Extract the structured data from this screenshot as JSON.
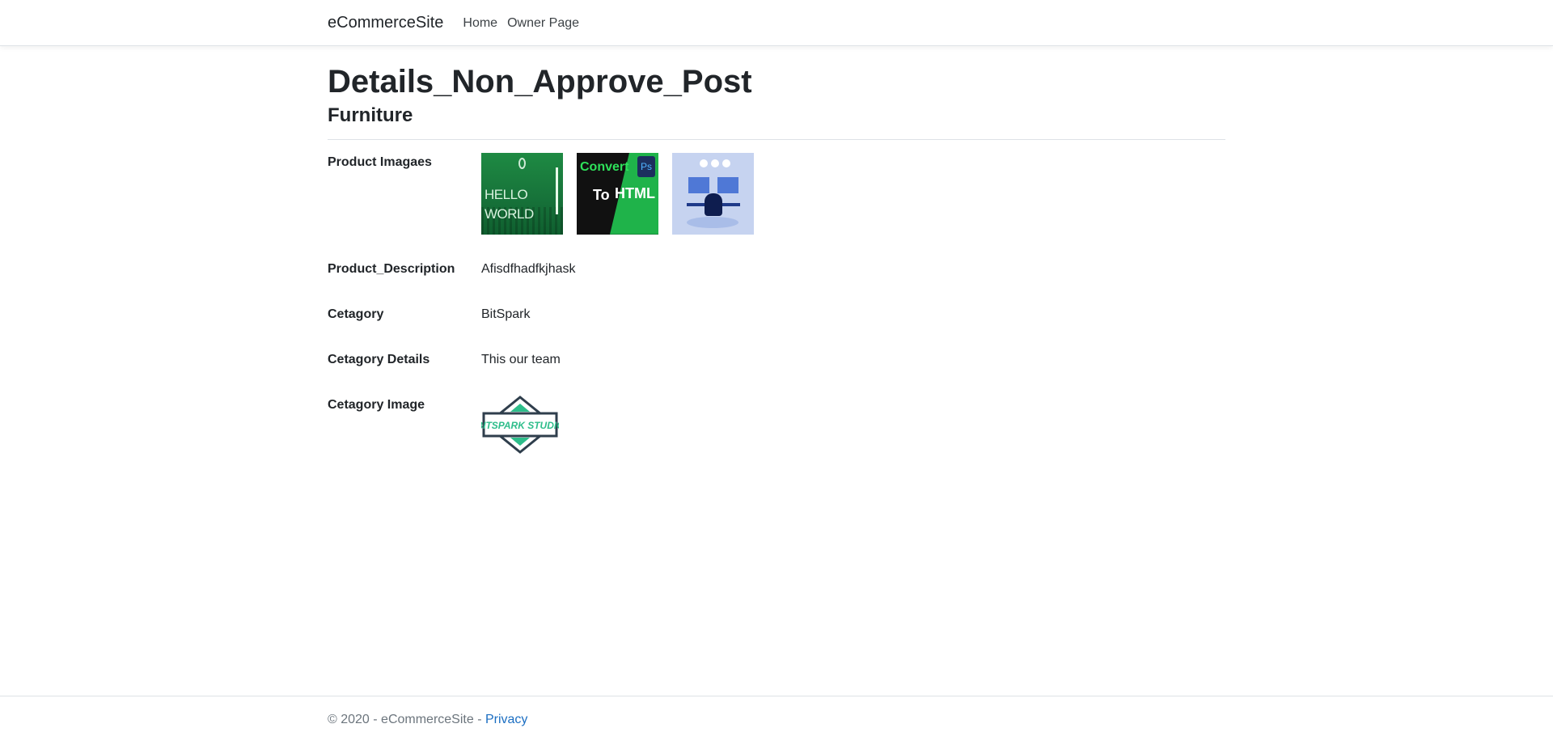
{
  "navbar": {
    "brand": "eCommerceSite",
    "links": [
      "Home",
      "Owner Page"
    ]
  },
  "page": {
    "title": "Details_Non_Approve_Post",
    "subtitle": "Furniture"
  },
  "details": {
    "product_images_label": "Product Imagaes",
    "product_images": [
      "hello-world-image",
      "convert-to-html-image",
      "developer-desk-image"
    ],
    "product_description_label": "Product_Description",
    "product_description_value": "Afisdfhadfkjhask",
    "category_label": "Cetagory",
    "category_value": "BitSpark",
    "category_details_label": "Cetagory Details",
    "category_details_value": "This our team",
    "category_image_label": "Cetagory Image",
    "category_logo_text": "BITSPARK STUDIO"
  },
  "thumb_text": {
    "hello": "HELLO WORLD",
    "convert": "Convert",
    "to": "To",
    "html": "HTML",
    "ps": "Ps"
  },
  "footer": {
    "copyright": "© 2020 - eCommerceSite - ",
    "privacy": "Privacy"
  },
  "colors": {
    "link": "#1b6ec2",
    "text": "#212529",
    "border": "#dee2e6"
  }
}
